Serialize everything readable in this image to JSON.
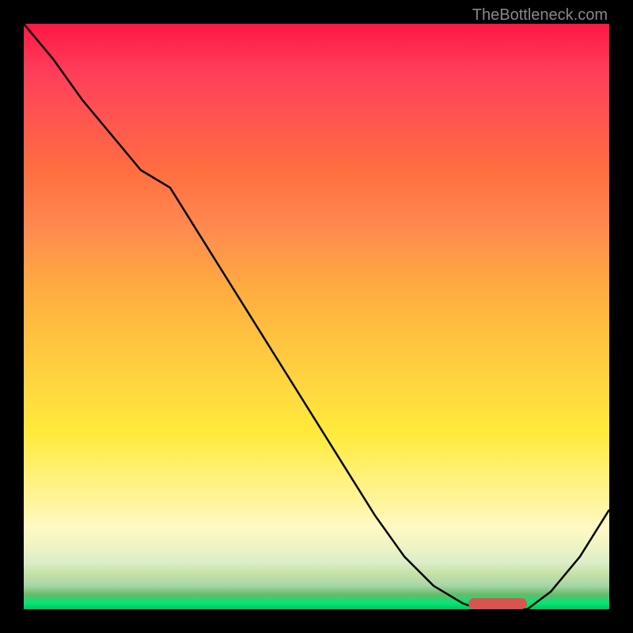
{
  "watermark": "TheBottleneck.com",
  "chart_data": {
    "type": "line",
    "title": "",
    "xlabel": "",
    "ylabel": "",
    "xlim": [
      0,
      100
    ],
    "ylim": [
      0,
      100
    ],
    "x": [
      0,
      5,
      10,
      15,
      20,
      25,
      30,
      35,
      40,
      45,
      50,
      55,
      60,
      65,
      70,
      75,
      78,
      82,
      86,
      90,
      95,
      100
    ],
    "values": [
      100,
      94,
      87,
      81,
      75,
      72,
      64,
      56,
      48,
      40,
      32,
      24,
      16,
      9,
      4,
      1,
      0,
      0,
      0,
      3,
      9,
      17
    ],
    "marker": {
      "x_start": 76,
      "x_end": 86,
      "y": 1
    },
    "gradient_colors": {
      "top": "#ff1744",
      "middle": "#ffeb3b",
      "bottom": "#00c853"
    }
  }
}
